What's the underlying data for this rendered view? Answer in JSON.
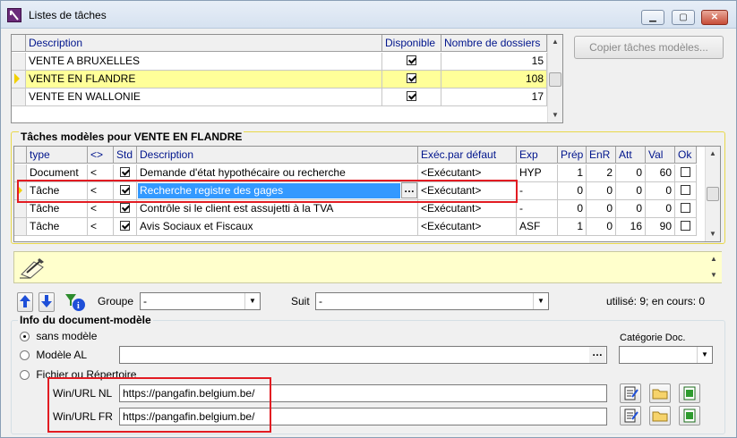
{
  "window": {
    "title": "Listes de tâches"
  },
  "lists": {
    "columns": [
      "Description",
      "Disponible",
      "Nombre de dossiers"
    ],
    "rows": [
      {
        "description": "VENTE A BRUXELLES",
        "disponible": true,
        "count": "15"
      },
      {
        "description": "VENTE EN FLANDRE",
        "disponible": true,
        "count": "108"
      },
      {
        "description": "VENTE EN WALLONIE",
        "disponible": true,
        "count": "17"
      }
    ],
    "copy_button": "Copier tâches modèles..."
  },
  "tasks": {
    "title": "Tâches modèles pour VENTE EN FLANDRE",
    "columns": [
      "type",
      "<>",
      "Std",
      "Description",
      "Exéc.par défaut",
      "Exp",
      "Prép",
      "EnR",
      "Att",
      "Val",
      "Ok"
    ],
    "rows": [
      {
        "type": "Document",
        "rel": "<",
        "std": true,
        "description": "Demande d'état hypothécaire ou recherche",
        "exec": "<Exécutant>",
        "exp": "HYP",
        "prep": "1",
        "enr": "2",
        "att": "0",
        "val": "60",
        "ok": false
      },
      {
        "type": "Tâche",
        "rel": "<",
        "std": true,
        "description": "Recherche registre des gages",
        "exec": "<Exécutant>",
        "exp": "-",
        "prep": "0",
        "enr": "0",
        "att": "0",
        "val": "0",
        "ok": false
      },
      {
        "type": "Tâche",
        "rel": "<",
        "std": true,
        "description": "Contrôle si le client est assujetti à la TVA",
        "exec": "<Exécutant>",
        "exp": "-",
        "prep": "0",
        "enr": "0",
        "att": "0",
        "val": "0",
        "ok": false
      },
      {
        "type": "Tâche",
        "rel": "<",
        "std": true,
        "description": "Avis Sociaux et Fiscaux",
        "exec": "<Exécutant>",
        "exp": "ASF",
        "prep": "1",
        "enr": "0",
        "att": "16",
        "val": "90",
        "ok": false
      }
    ],
    "ellipsis": "…"
  },
  "toolbar": {
    "groupe_label": "Groupe",
    "groupe_value": "-",
    "suit_label": "Suit",
    "suit_value": "-",
    "usage": "utilisé: 9; en cours: 0"
  },
  "info": {
    "title": "Info du document-modèle",
    "options": [
      "sans modèle",
      "Modèle AL",
      "Fichier ou Répertoire"
    ],
    "selected_option": "sans modèle",
    "categorie_label": "Catégorie Doc.",
    "modele_ellipsis": "…",
    "nl_label": "Win/URL NL",
    "nl_value": "https://pangafin.belgium.be/",
    "fr_label": "Win/URL FR",
    "fr_value": "https://pangafin.belgium.be/"
  },
  "colors": {
    "selected_row": "#ffff99",
    "highlight": "#3399ff",
    "annotation": "#e21b22"
  }
}
